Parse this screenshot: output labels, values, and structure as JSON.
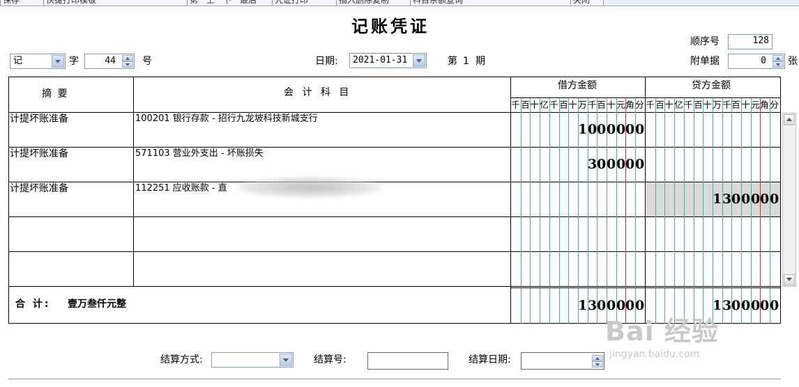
{
  "toolbar": {
    "items": [
      "保存",
      "快捷打印模板",
      "第一上一下一最后",
      "凭证打印",
      "插入删除复制",
      "科目余额查询",
      "关闭"
    ]
  },
  "voucher": {
    "title": "记账凭证",
    "sequence_label": "顺序号",
    "sequence_value": "128",
    "type_value": "记",
    "zi_label": "字",
    "number_value": "44",
    "hao_label": "号",
    "date_label": "日期:",
    "date_value": "2021-01-31",
    "period_prefix": "第",
    "period_value": "1",
    "period_suffix": "期",
    "attach_label": "附单据",
    "attach_value": "0",
    "attach_unit": "张"
  },
  "table": {
    "col_summary": "摘  要",
    "col_account": "会 计 科 目",
    "col_debit": "借方金额",
    "col_credit": "贷方金额",
    "units": [
      "千",
      "百",
      "十",
      "亿",
      "千",
      "百",
      "十",
      "万",
      "千",
      "百",
      "十",
      "元",
      "角",
      "分"
    ],
    "rows": [
      {
        "summary": "计提坏账准备",
        "account": "100201 银行存款 - 招行九龙坡科技新城支行",
        "debit": "1000000",
        "credit": ""
      },
      {
        "summary": "计提坏账准备",
        "account": "571103 营业外支出 - 坏账损失",
        "debit": "300000",
        "credit": ""
      },
      {
        "summary": "计提坏账准备",
        "account": "112251 应收账款 - 直",
        "debit": "",
        "credit": "1300000"
      },
      {
        "summary": "",
        "account": "",
        "debit": "",
        "credit": ""
      },
      {
        "summary": "",
        "account": "",
        "debit": "",
        "credit": ""
      }
    ],
    "total_label": "合  计:",
    "total_words": "壹万叁仟元整",
    "total_debit": "1300000",
    "total_credit": "1300000"
  },
  "settlement": {
    "method_label": "结算方式:",
    "method_value": "",
    "number_label": "结算号:",
    "number_value": "",
    "date_label": "结算日期:",
    "date_value": ""
  },
  "watermark": {
    "brand": "Bai 经验",
    "url": "jingyan.baidu.com"
  },
  "colors": {
    "grid_teal": "#3bb3a3",
    "grid_red": "#d42a2a",
    "highlight": "#d9d9d9",
    "input_border": "#7f9db9"
  }
}
